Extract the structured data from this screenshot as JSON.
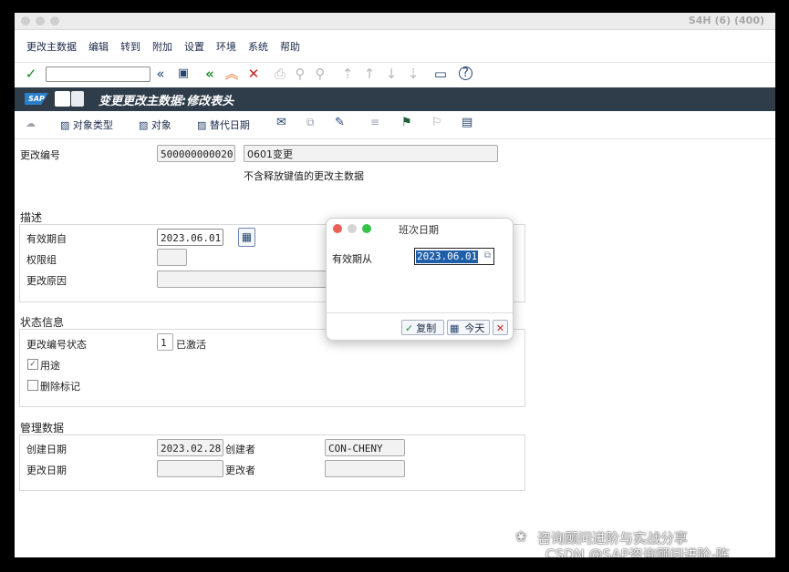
{
  "window": {
    "title": "S4H (6) (400)"
  },
  "menu": [
    "更改主数据",
    "编辑",
    "转到",
    "附加",
    "设置",
    "环境",
    "系统",
    "帮助"
  ],
  "page_title": "变更更改主数据:修改表头",
  "app_toolbar": {
    "object_type": "对象类型",
    "object": "对象",
    "alt_date": "替代日期"
  },
  "change_no": {
    "label": "更改编号",
    "value": "500000000020",
    "desc": "0601变更",
    "note": "不含释放键值的更改主数据"
  },
  "description": {
    "title": "描述",
    "valid_from_label": "有效期自",
    "valid_from": "2023.06.01",
    "auth_group_label": "权限组",
    "reason_label": "更改原因"
  },
  "status": {
    "title": "状态信息",
    "status_label": "更改编号状态",
    "status_value": "1",
    "status_text": "已激活",
    "usage_label": "用途",
    "deletion_label": "删除标记"
  },
  "admin": {
    "title": "管理数据",
    "created_on_label": "创建日期",
    "created_on": "2023.02.28",
    "created_by_label": "创建者",
    "created_by": "CON-CHENY",
    "changed_on_label": "更改日期",
    "changed_by_label": "更改者"
  },
  "dialog": {
    "title": "班次日期",
    "field_label": "有效期从",
    "field_value": "2023.06.01",
    "copy_label": "复制",
    "today_label": "今天"
  },
  "watermark": {
    "line1": "咨询顾问进阶与实战分享",
    "line2": "CSDN @SAP咨询顾问进阶-陈"
  },
  "colors": {
    "header_bg": "#2f3c4a",
    "accent": "#1f5ea8",
    "confirm_green": "#1a8a2a",
    "cancel_red": "#d02020"
  }
}
